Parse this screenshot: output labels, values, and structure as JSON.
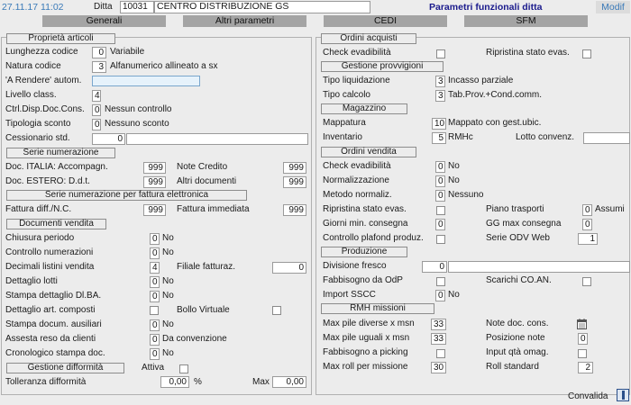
{
  "header": {
    "datetime": "27.11.17 11:02",
    "ditta_label": "Ditta",
    "ditta_code": "10031",
    "ditta_name": "CENTRO DISTRIBUZIONE GS",
    "title": "Parametri funzionali ditta",
    "modif": "Modif"
  },
  "tabs": [
    "Generali",
    "Altri parametri",
    "CEDI",
    "SFM"
  ],
  "left": {
    "proprieta": {
      "title": "Proprietà articoli",
      "lunghezza_label": "Lunghezza codice",
      "lunghezza_val": "0",
      "lunghezza_desc": "Variabile",
      "natura_label": "Natura codice",
      "natura_val": "3",
      "natura_desc": "Alfanumerico allineato a sx",
      "arendere_label": "'A Rendere' autom.",
      "arendere_val": "",
      "livello_label": "Livello class.",
      "livello_val": "4",
      "ctrl_label": "Ctrl.Disp.Doc.Cons.",
      "ctrl_val": "0",
      "ctrl_desc": "Nessun controllo",
      "tipologia_label": "Tipologia sconto",
      "tipologia_val": "0",
      "tipologia_desc": "Nessuno sconto",
      "cessionario_label": "Cessionario std.",
      "cessionario_val": "0",
      "cessionario_desc": ""
    },
    "serie": {
      "title": "Serie numerazione",
      "italia_label": "Doc. ITALIA: Accompagn.",
      "italia_val": "999",
      "note_label": "Note Credito",
      "note_val": "999",
      "estero_label": "Doc. ESTERO: D.d.t.",
      "estero_val": "999",
      "altri_label": "Altri documenti",
      "altri_val": "999"
    },
    "serie_fe": {
      "title": "Serie numerazione per fattura elettronica",
      "diff_label": "Fattura diff./N.C.",
      "diff_val": "999",
      "imm_label": "Fattura immediata",
      "imm_val": "999"
    },
    "documenti": {
      "title": "Documenti vendita",
      "chiusura_label": "Chiusura periodo",
      "chiusura_val": "0",
      "chiusura_desc": "No",
      "controllo_label": "Controllo numerazioni",
      "controllo_val": "0",
      "controllo_desc": "No",
      "decimali_label": "Decimali listini vendita",
      "decimali_val": "4",
      "filiale_label": "Filiale fatturaz.",
      "filiale_val": "0",
      "lotti_label": "Dettaglio lotti",
      "lotti_val": "0",
      "lotti_desc": "No",
      "stampa_dl_label": "Stampa dettaglio Dl.BA.",
      "stampa_dl_val": "0",
      "stampa_dl_desc": "No",
      "art_label": "Dettaglio art. composti",
      "bollo_label": "Bollo Virtuale",
      "aus_label": "Stampa docum. ausiliari",
      "aus_val": "0",
      "aus_desc": "No",
      "reso_label": "Assesta reso da clienti",
      "reso_val": "0",
      "reso_desc": "Da convenzione",
      "crono_label": "Cronologico stampa doc.",
      "crono_val": "0",
      "crono_desc": "No"
    },
    "difformita": {
      "title": "Gestione difformità",
      "attiva_label": "Attiva",
      "toll_label": "Tolleranza difformità",
      "toll_val": "0,00",
      "toll_unit": "%",
      "max_label": "Max",
      "max_val": "0,00"
    }
  },
  "right": {
    "ordini_acq": {
      "title": "Ordini acquisti",
      "check_label": "Check evadibilità",
      "ripristina_label": "Ripristina stato evas."
    },
    "provvigioni": {
      "title": "Gestione provvigioni",
      "tipo_liq_label": "Tipo liquidazione",
      "tipo_liq_val": "3",
      "tipo_liq_desc": "Incasso parziale",
      "tipo_calc_label": "Tipo calcolo",
      "tipo_calc_val": "3",
      "tipo_calc_desc": "Tab.Prov.+Cond.comm."
    },
    "magazzino": {
      "title": "Magazzino",
      "mappatura_label": "Mappatura",
      "mappatura_val": "10",
      "mappatura_desc": "Mappato con gest.ubic.",
      "inventario_label": "Inventario",
      "inventario_val": "5",
      "inventario_desc": "RMHc",
      "lotto_label": "Lotto convenz.",
      "lotto_val": ""
    },
    "ordini_ven": {
      "title": "Ordini vendita",
      "check_label": "Check evadibilità",
      "check_val": "0",
      "check_desc": "No",
      "norm_label": "Normalizzazione",
      "norm_val": "0",
      "norm_desc": "No",
      "metodo_label": "Metodo normaliz.",
      "metodo_val": "0",
      "metodo_desc": "Nessuno",
      "ripristina_label": "Ripristina stato evas.",
      "piano_label": "Piano trasporti",
      "piano_val": "0",
      "piano_desc": "Assumi",
      "giorni_label": "Giorni min. consegna",
      "giorni_val": "0",
      "gg_label": "GG max consegna",
      "gg_val": "0",
      "plafond_label": "Controllo plafond produz.",
      "serie_label": "Serie ODV Web",
      "serie_val": "1"
    },
    "produzione": {
      "title": "Produzione",
      "divisione_label": "Divisione fresco",
      "divisione_val": "0",
      "divisione_desc": "",
      "fabb_label": "Fabbisogno da OdP",
      "scarichi_label": "Scarichi CO.AN.",
      "sscc_label": "Import SSCC",
      "sscc_val": "0",
      "sscc_desc": "No"
    },
    "rmh": {
      "title": "RMH missioni",
      "pile_div_label": "Max pile diverse x msn",
      "pile_div_val": "33",
      "note_label": "Note doc. cons.",
      "pile_ug_label": "Max pile uguali  x msn",
      "pile_ug_val": "33",
      "pos_label": "Posizione note",
      "pos_val": "0",
      "picking_label": "Fabbisogno a picking",
      "input_label": "Input qtà omag.",
      "roll_label": "Max roll per missione",
      "roll_val": "30",
      "rollstd_label": "Roll  standard",
      "rollstd_val": "2"
    }
  },
  "footer": {
    "convalida": "Convalida"
  },
  "colors": {
    "title": "#1a1a8c",
    "datetime": "#3a7ab8",
    "tab": "#a4a4a4"
  }
}
